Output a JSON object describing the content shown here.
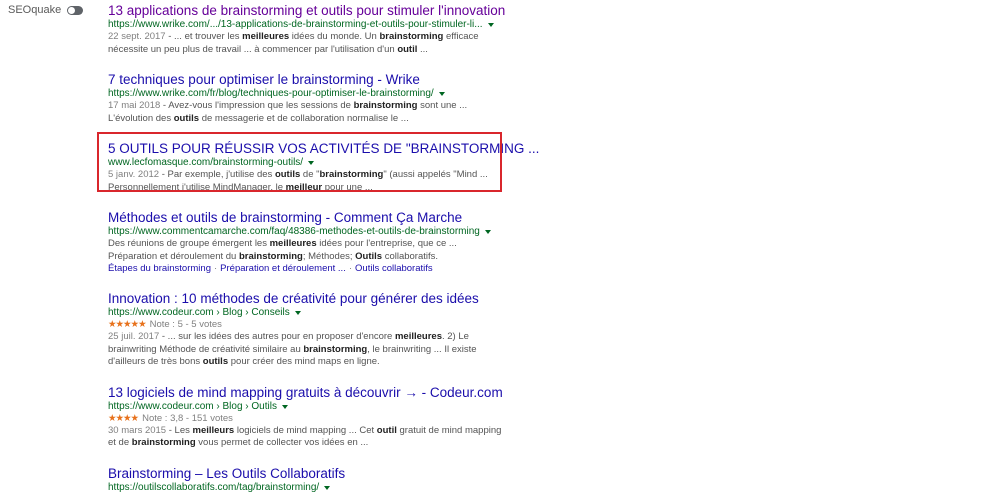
{
  "seoquake": {
    "label": "SEOquake"
  },
  "results": [
    {
      "title": "13 applications de brainstorming et outils pour stimuler l'innovation",
      "url": "https://www.wrike.com/.../13-applications-de-brainstorming-et-outils-pour-stimuler-li...",
      "date": "22 sept. 2017",
      "snippet_parts": [
        {
          "t": " - ... et trouver les ",
          "b": false
        },
        {
          "t": "meilleures",
          "b": true
        },
        {
          "t": " idées du monde. Un ",
          "b": false
        },
        {
          "t": "brainstorming",
          "b": true
        },
        {
          "t": " efficace nécessite un peu plus de travail ... à commencer par l'utilisation d'un ",
          "b": false
        },
        {
          "t": "outil",
          "b": true
        },
        {
          "t": " ...",
          "b": false
        }
      ]
    },
    {
      "title": "7 techniques pour optimiser le brainstorming - Wrike",
      "url": "https://www.wrike.com/fr/blog/techniques-pour-optimiser-le-brainstorming/",
      "date": "17 mai 2018",
      "snippet_parts": [
        {
          "t": " - Avez-vous l'impression que les sessions de ",
          "b": false
        },
        {
          "t": "brainstorming",
          "b": true
        },
        {
          "t": " sont une ... L'évolution des ",
          "b": false
        },
        {
          "t": "outils",
          "b": true
        },
        {
          "t": " de messagerie et de collaboration normalise le ...",
          "b": false
        }
      ]
    },
    {
      "title": "5 OUTILS POUR RÉUSSIR VOS ACTIVITÉS DE \"BRAINSTORMING ...",
      "url": "www.lecfomasque.com/brainstorming-outils/",
      "date": "5 janv. 2012",
      "snippet_parts": [
        {
          "t": " - Par exemple, j'utilise des ",
          "b": false
        },
        {
          "t": "outils",
          "b": true
        },
        {
          "t": " de \"",
          "b": false
        },
        {
          "t": "brainstorming",
          "b": true
        },
        {
          "t": "\" (aussi appelés \"Mind ... Personnellement j'utilise MindManager, le ",
          "b": false
        },
        {
          "t": "meilleur",
          "b": true
        },
        {
          "t": " pour une ...",
          "b": false
        }
      ]
    },
    {
      "title": "Méthodes et outils de brainstorming - Comment Ça Marche",
      "url": "https://www.commentcamarche.com/faq/48386-methodes-et-outils-de-brainstorming",
      "snippet_parts": [
        {
          "t": "Des réunions de groupe émergent les ",
          "b": false
        },
        {
          "t": "meilleures",
          "b": true
        },
        {
          "t": " idées pour l'entreprise, que ce ... Préparation et déroulement du ",
          "b": false
        },
        {
          "t": "brainstorming",
          "b": true
        },
        {
          "t": "; Méthodes; ",
          "b": false
        },
        {
          "t": "Outils",
          "b": true
        },
        {
          "t": " collaboratifs.",
          "b": false
        }
      ],
      "sitelinks": [
        "Étapes du brainstorming",
        "Préparation et déroulement ...",
        "Outils collaboratifs"
      ]
    },
    {
      "title": "Innovation : 10 méthodes de créativité pour générer des idées",
      "url": "https://www.codeur.com › Blog › Conseils",
      "stars": "★★★★★",
      "rating": "Note : 5 - 5 votes",
      "date": "25 juil. 2017",
      "snippet_parts": [
        {
          "t": " - ... sur les idées des autres pour en proposer d'encore ",
          "b": false
        },
        {
          "t": "meilleures",
          "b": true
        },
        {
          "t": ". 2) Le brainwriting Méthode de créativité similaire au ",
          "b": false
        },
        {
          "t": "brainstorming",
          "b": true
        },
        {
          "t": ", le brainwriting ... Il existe d'ailleurs de très bons ",
          "b": false
        },
        {
          "t": "outils",
          "b": true
        },
        {
          "t": " pour créer des mind maps en ligne.",
          "b": false
        }
      ]
    },
    {
      "title": "13 logiciels de mind mapping gratuits à découvrir → - Codeur.com",
      "url": "https://www.codeur.com › Blog › Outils",
      "stars": "★★★★",
      "rating": "Note : 3,8 - 151 votes",
      "date": "30 mars 2015",
      "snippet_parts": [
        {
          "t": " - Les ",
          "b": false
        },
        {
          "t": "meilleurs",
          "b": true
        },
        {
          "t": " logiciels de mind mapping ... Cet ",
          "b": false
        },
        {
          "t": "outil",
          "b": true
        },
        {
          "t": " gratuit de mind mapping et de ",
          "b": false
        },
        {
          "t": "brainstorming",
          "b": true
        },
        {
          "t": " vous permet de collecter vos idées en ...",
          "b": false
        }
      ]
    },
    {
      "title": "Brainstorming – Les Outils Collaboratifs",
      "url": "https://outilscollaboratifs.com/tag/brainstorming/"
    }
  ]
}
